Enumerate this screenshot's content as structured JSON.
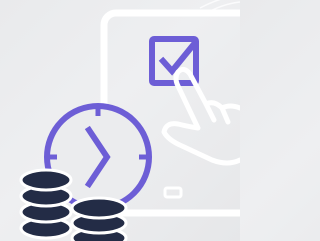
{
  "illustration": {
    "icons": [
      "tablet-icon",
      "checkbox-checked-icon",
      "pointing-hand-icon",
      "clock-icon",
      "coin-stack-icon"
    ],
    "colors": {
      "background": "#ebecee",
      "device_outline": "#ffffff",
      "accent_purple": "#6d5ed6",
      "coin_navy": "#232c46",
      "coin_edge": "#ffffff"
    }
  }
}
